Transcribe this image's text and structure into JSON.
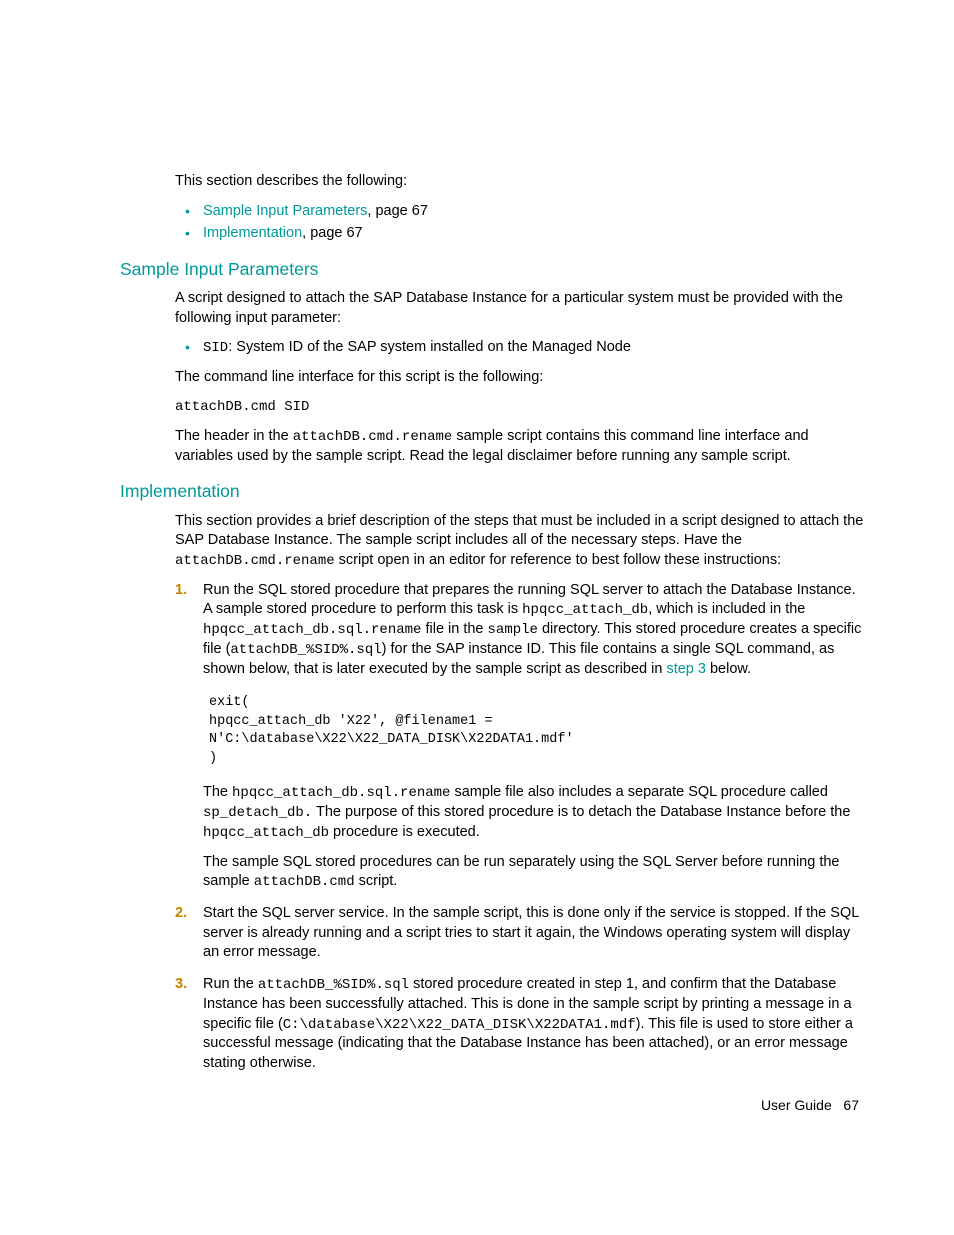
{
  "intro": "This section describes the following:",
  "toc": [
    {
      "label": "Sample Input Parameters",
      "suffix": ", page 67"
    },
    {
      "label": "Implementation",
      "suffix": ", page 67"
    }
  ],
  "sec1": {
    "title": "Sample Input Parameters",
    "p1": "A script designed to attach the SAP Database Instance for a particular system must be provided with the following input parameter:",
    "bullet_code": "SID",
    "bullet_text": ": System ID of the SAP system installed on the Managed Node",
    "p2": "The command line interface for this script is the following:",
    "cmd": "attachDB.cmd SID",
    "p3a": "The header in the ",
    "p3code": "attachDB.cmd.rename",
    "p3b": " sample script contains this command line interface and variables used by the sample script. Read the legal disclaimer before running any sample script."
  },
  "sec2": {
    "title": "Implementation",
    "p1a": "This section provides a brief description of the steps that must be included in a script designed to attach the SAP Database Instance. The sample script includes all of the necessary steps. Have the ",
    "p1code": "attachDB.cmd.rename",
    "p1b": " script open in an editor for reference to best follow these instructions:",
    "step1": {
      "a": "Run the SQL stored procedure that prepares the running SQL server to attach the Database Instance. A sample stored procedure to perform this task is ",
      "c1": "hpqcc_attach_db",
      "b": ", which is included in the ",
      "c2": "hpqcc_attach_db.sql.rename",
      "c": " file in the ",
      "c3": "sample",
      "d": " directory. This stored procedure creates a specific file (",
      "c4": "attachDB_%SID%.sql",
      "e": ") for the SAP instance ID. This file contains a single SQL command, as shown below, that is later executed by the sample script as described in ",
      "link": "step 3",
      "f": " below.",
      "code": "exit(\nhpqcc_attach_db 'X22', @filename1 =\nN'C:\\database\\X22\\X22_DATA_DISK\\X22DATA1.mdf'\n)",
      "p2a": "The ",
      "p2c1": "hpqcc_attach_db.sql.rename",
      "p2b": " sample file also includes a separate SQL procedure called ",
      "p2c2": "sp_detach_db.",
      "p2c": " The purpose of this stored procedure is to detach the Database Instance before the ",
      "p2c3": "hpqcc_attach_db",
      "p2d": " procedure is executed.",
      "p3a": "The sample SQL stored procedures can be run separately using the SQL Server before running the sample ",
      "p3c": "attachDB.cmd",
      "p3b": " script."
    },
    "step2": "Start the SQL server service. In the sample script, this is done only if the service is stopped. If the SQL server is already running and a script tries to start it again, the Windows operating system will display an error message.",
    "step3": {
      "a": "Run the ",
      "c1": "attachDB_%SID%.sql",
      "b": " stored procedure created in step 1, and confirm that the Database Instance has been successfully attached. This is done in the sample script by printing a message in a specific file (",
      "c2": "C:\\database\\X22\\X22_DATA_DISK\\X22DATA1.mdf",
      "c": "). This file is used to store either a successful message (indicating that the Database Instance has been attached), or an error message stating otherwise."
    }
  },
  "footer": {
    "label": "User Guide",
    "page": "67"
  }
}
